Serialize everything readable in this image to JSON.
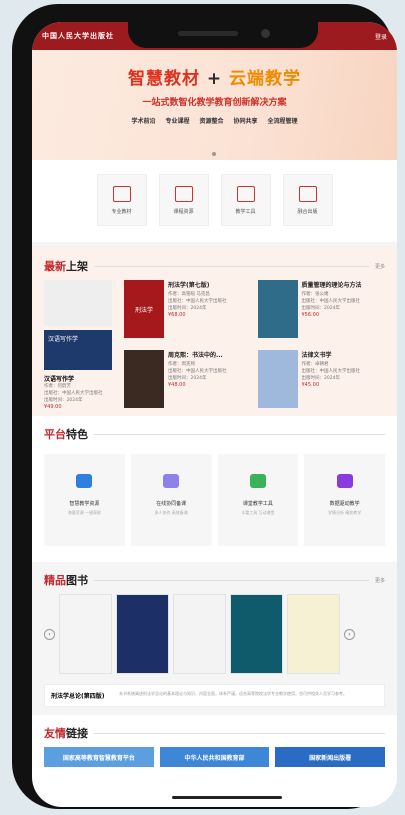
{
  "topbar": {
    "logo": "中国人民大学出版社",
    "right": "登录"
  },
  "banner": {
    "h1_part1": "智慧教材",
    "h1_plus": " + ",
    "h1_part2": "云端教学",
    "h2": "一站式数智化教学教育创新解决方案",
    "tags": [
      "学术前沿",
      "专业课程",
      "资源整合",
      "协同共享",
      "全流程管理"
    ]
  },
  "quick": [
    "专业教材",
    "课程资源",
    "教学工具",
    "融合出版"
  ],
  "new": {
    "title_red": "最新",
    "title_rest": "上架",
    "more": "更多",
    "featured": {
      "cover_text": "汉语写作学",
      "title": "汉语写作学",
      "meta1": "作者：何蔚芳",
      "meta2": "出版社：中国人民大学出版社",
      "meta3": "出版时间：2024年",
      "price": "¥49.00"
    },
    "books": [
      {
        "title": "刑法学(第七版)",
        "cover": "刑法学",
        "meta1": "作者：高铭暄 马克昌",
        "meta2": "出版社：中国人民大学出版社",
        "meta3": "出版时间：2024年",
        "price": "¥68.00",
        "color": "#a5191c"
      },
      {
        "title": "质量管理的理论与方法",
        "cover": "",
        "meta1": "作者：张公绪",
        "meta2": "出版社：中国人民大学出版社",
        "meta3": "出版时间：2024年",
        "price": "¥56.00",
        "color": "#2f6c8a"
      },
      {
        "title": "周克熙：书法中的...",
        "cover": "",
        "meta1": "作者：周克熙",
        "meta2": "出版社：中国人民大学出版社",
        "meta3": "出版时间：2024年",
        "price": "¥48.00",
        "color": "#3a2a22"
      },
      {
        "title": "法律文书学",
        "cover": "",
        "meta1": "作者：卓朝君",
        "meta2": "出版社：中国人民大学出版社",
        "meta3": "出版时间：2024年",
        "price": "¥45.00",
        "color": "#9fb9dd"
      }
    ]
  },
  "platform": {
    "title_red": "平台",
    "title_rest": "特色",
    "cards": [
      {
        "title": "智慧教学资源",
        "desc": "海量资源 一键获取",
        "color": "#2f7fe0"
      },
      {
        "title": "在线协同备课",
        "desc": "多人协作 高效备课",
        "color": "#8b83e8"
      },
      {
        "title": "课堂教学工具",
        "desc": "丰富工具 互动课堂",
        "color": "#3bb25a"
      },
      {
        "title": "数据驱动教学",
        "desc": "学情分析 精准教学",
        "color": "#8a3be0"
      }
    ]
  },
  "fine": {
    "title_red": "精品",
    "title_rest": "图书",
    "more": "更多",
    "covers": [
      {
        "color": "#f4f4f4"
      },
      {
        "color": "#1c2f66"
      },
      {
        "color": "#f3f3f3"
      },
      {
        "color": "#0f5a6b"
      },
      {
        "color": "#f6f1d2"
      }
    ],
    "info_name": "刑法学总论(第四版)",
    "info_desc": "本书系统阐述刑法学总论的基本理论与知识，内容全面，体系严谨，适合高等院校法学专业教学使用，也可供相关人员学习参考。"
  },
  "links": {
    "title_red": "友情",
    "title_rest": "链接",
    "items": [
      {
        "label": "国家高等教育智慧教育平台",
        "color": "#5b9fe0"
      },
      {
        "label": "中华人民共和国教育部",
        "color": "#3e86d6"
      },
      {
        "label": "国家新闻出版署",
        "color": "#2a6cc4"
      }
    ]
  }
}
